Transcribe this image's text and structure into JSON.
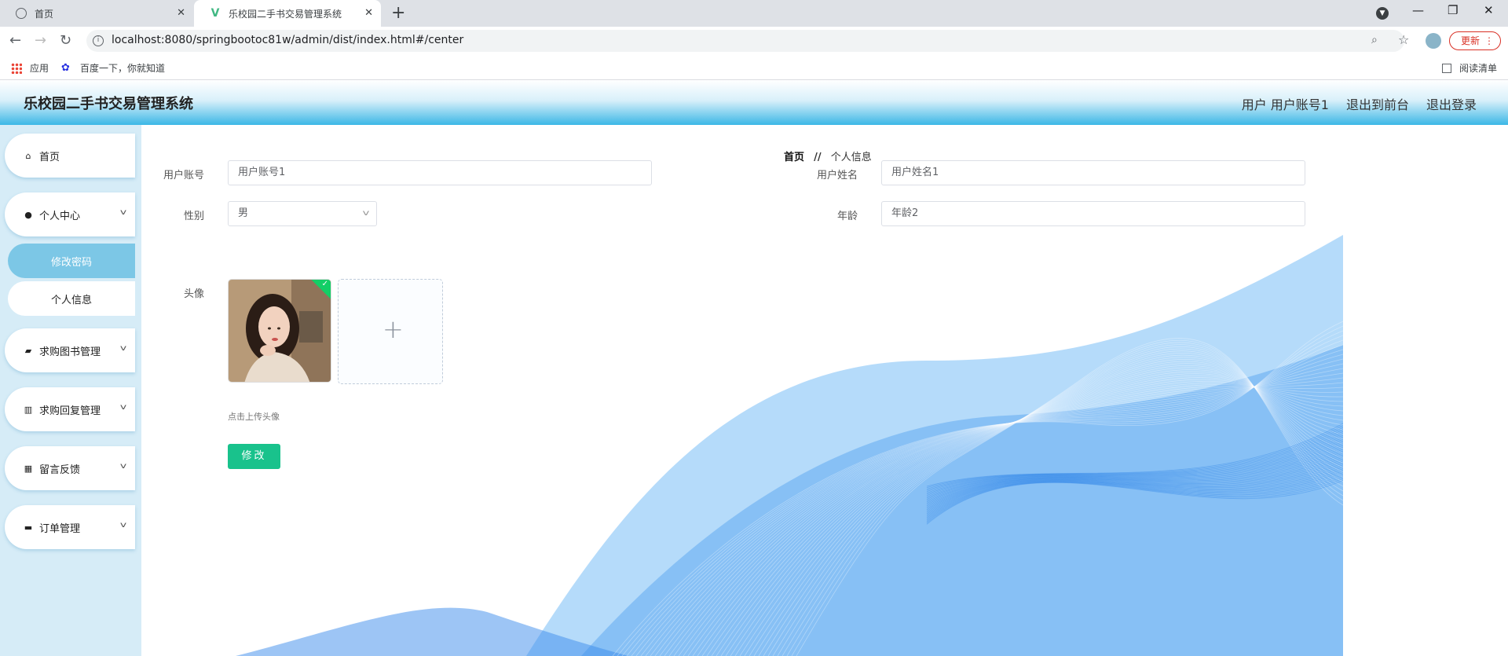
{
  "browser": {
    "tabs": [
      {
        "title": "首页",
        "favicon": "globe-icon"
      },
      {
        "title": "乐校园二手书交易管理系统",
        "favicon": "vue-icon"
      }
    ],
    "url": "localhost:8080/springbootoc81w/admin/dist/index.html#/center",
    "update_label": "更新",
    "bookmarks": [
      "应用",
      "百度一下，你就知道"
    ],
    "reading_list": "阅读清单"
  },
  "header": {
    "title": "乐校园二手书交易管理系统",
    "user": "用户 用户账号1",
    "to_front": "退出到前台",
    "logout": "退出登录"
  },
  "sidebar": {
    "home": "首页",
    "personal_center": "个人中心",
    "change_password": "修改密码",
    "personal_info": "个人信息",
    "book_requests": "求购图书管理",
    "request_replies": "求购回复管理",
    "feedback": "留言反馈",
    "orders": "订单管理"
  },
  "breadcrumb": {
    "home": "首页",
    "sep": "//",
    "current": "个人信息"
  },
  "form": {
    "account_label": "用户账号",
    "account_value": "用户账号1",
    "name_label": "用户姓名",
    "name_value": "用户姓名1",
    "gender_label": "性别",
    "gender_value": "男",
    "age_label": "年龄",
    "age_value": "年龄2",
    "avatar_label": "头像",
    "upload_tip": "点击上传头像",
    "submit_label": "修改"
  },
  "colors": {
    "accent": "#19c28c",
    "header_gradient_end": "#3cb7e6",
    "sidebar_bg": "#d6ecf7",
    "active_item": "#7cc7e6"
  }
}
